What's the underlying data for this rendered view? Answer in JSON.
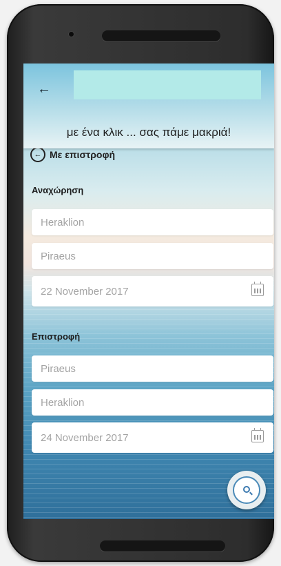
{
  "header": {
    "back_icon": "arrow-left-icon",
    "slogan": "με ένα κλικ ... σας πάμε μακριά!"
  },
  "toggle": {
    "label": "Με επιστροφή"
  },
  "departure": {
    "label": "Αναχώρηση",
    "from": "Heraklion",
    "to": "Piraeus",
    "date": "22 November 2017"
  },
  "return": {
    "label": "Επιστροφή",
    "from": "Piraeus",
    "to": "Heraklion",
    "date": "24 November 2017"
  },
  "icons": {
    "calendar": "calendar-icon",
    "search": "search-icon"
  },
  "colors": {
    "header_top": "#7cc4de",
    "title_box": "#b3eae8",
    "accent": "#3c7ab0"
  }
}
